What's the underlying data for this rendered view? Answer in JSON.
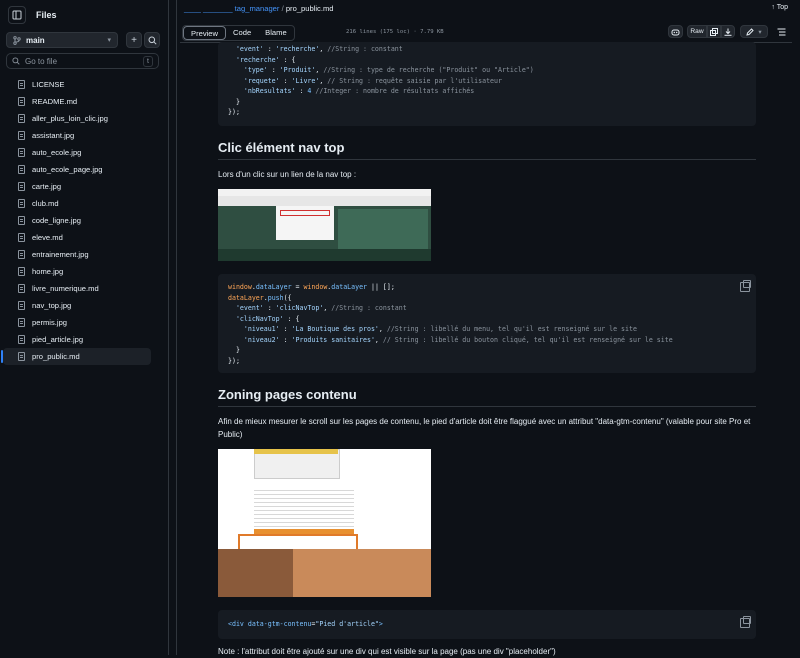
{
  "sidebar": {
    "title": "Files",
    "branch": "main",
    "search_placeholder": "Go to file",
    "search_shortcut": "t",
    "files": [
      "LICENSE",
      "README.md",
      "aller_plus_loin_clic.jpg",
      "assistant.jpg",
      "auto_ecole.jpg",
      "auto_ecole_page.jpg",
      "carte.jpg",
      "club.md",
      "code_ligne.jpg",
      "eleve.md",
      "entrainement.jpg",
      "home.jpg",
      "livre_numerique.md",
      "nav_top.jpg",
      "permis.jpg",
      "pied_article.jpg",
      "pro_public.md"
    ],
    "active_file": "pro_public.md"
  },
  "breadcrumb": {
    "repo": "____ _______ tag_manager",
    "sep": "/",
    "file": "pro_public.md"
  },
  "top_link": "Top",
  "filebar": {
    "tabs": [
      "Preview",
      "Code",
      "Blame"
    ],
    "active_tab": "Preview",
    "meta": "216 lines (175 loc) · 7.79 KB",
    "raw_label": "Raw"
  },
  "code1": [
    "  'event' : 'recherche', //String : constant",
    "  'recherche' : {",
    "    'type' : 'Produit', //String : type de recherche (\"Produit\" ou \"Article\")",
    "    'requete' : 'Livre', // String : requête saisie par l'utilisateur",
    "    'nbResultats' : 4 //Integer : nombre de résultats affichés",
    "  }",
    "});"
  ],
  "section1": {
    "heading": "Clic élément nav top",
    "text": "Lors d'un clic sur un lien de la nav top :"
  },
  "code2": [
    "window.dataLayer = window.dataLayer || [];",
    "dataLayer.push({",
    "  'event' : 'clicNavTop', //String : constant",
    "  'clicNavTop' : {",
    "    'niveau1' : 'La Boutique des pros', //String : libellé du menu, tel qu'il est renseigné sur le site",
    "    'niveau2' : 'Produits sanitaires', // String : libellé du bouton cliqué, tel qu'il est renseigné sur le site",
    "  }",
    "});"
  ],
  "section2": {
    "heading": "Zoning pages contenu",
    "text": "Afin de mieux mesurer le scroll sur les pages de contenu, le pied d'article doit être flaggué avec un attribut \"data-gtm-contenu\" (valable pour site Pro et Public)"
  },
  "code3": {
    "tag_open": "<div",
    "attr": "data-gtm-contenu",
    "eq": "=",
    "value": "\"Pied d'article\"",
    "tag_close": ">"
  },
  "note": "Note : l'attribut doit être ajouté sur une div qui est visible sur la page (pas une div \"placeholder\")",
  "colors": {
    "bg": "#0d1117",
    "accent": "#2f81f7",
    "link": "#4493f8",
    "code_bg": "#161b22",
    "border": "#30363d"
  }
}
